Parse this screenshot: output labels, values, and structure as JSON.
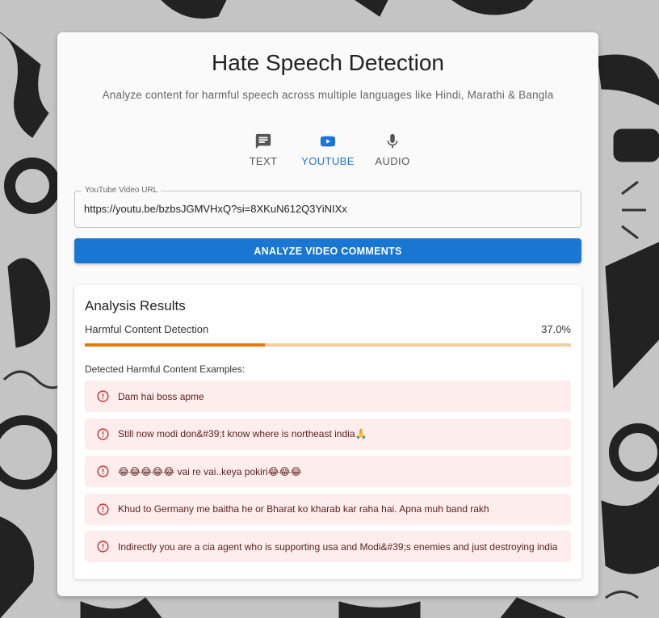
{
  "header": {
    "title": "Hate Speech Detection",
    "subtitle": "Analyze content for harmful speech across multiple languages like Hindi, Marathi & Bangla"
  },
  "tabs": [
    {
      "label": "TEXT",
      "icon": "message-icon",
      "active": false
    },
    {
      "label": "YOUTUBE",
      "icon": "youtube-icon",
      "active": true
    },
    {
      "label": "AUDIO",
      "icon": "microphone-icon",
      "active": false
    }
  ],
  "url_field": {
    "label": "YouTube Video URL",
    "value": "https://youtu.be/bzbsJGMVHxQ?si=8XKuN612Q3YiNIXx"
  },
  "analyze_button": {
    "label": "ANALYZE VIDEO COMMENTS"
  },
  "results": {
    "title": "Analysis Results",
    "metric_label": "Harmful Content Detection",
    "metric_value": "37.0%",
    "progress_fraction": 0.37,
    "examples_label": "Detected Harmful Content Examples:",
    "examples": [
      "Dam hai boss apme",
      "Still now modi don&#39;t know where is northeast india🙏",
      "😂😂😂😂😂 vai re vai..keya pokiri😂😂😂",
      "Khud to Germany me baitha he or Bharat ko kharab kar raha hai. Apna muh band rakh",
      "Indirectly you are a cia agent who is supporting usa and Modi&#39;s enemies and just destroying india"
    ]
  },
  "colors": {
    "primary": "#1976d2",
    "progress_fill": "#e07b12",
    "progress_track": "#f3cda3",
    "error_bg": "#fdeded",
    "error_icon": "#d32f2f",
    "error_text": "#5f2120"
  }
}
